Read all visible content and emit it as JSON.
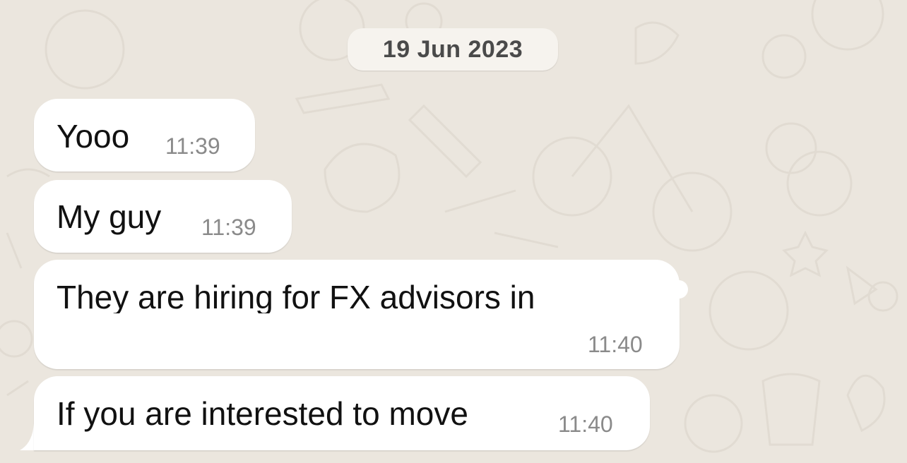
{
  "chat": {
    "date_separator": "19 Jun 2023",
    "messages": [
      {
        "text": "Yooo",
        "time": "11:39"
      },
      {
        "text": "My guy",
        "time": "11:39"
      },
      {
        "text": "They are hiring for FX advisors in ",
        "time": "11:40"
      },
      {
        "text": "If you  are interested to move",
        "time": "11:40"
      }
    ]
  },
  "colors": {
    "wallpaper": "#ebe6de",
    "bubble": "#ffffff",
    "timestamp": "#8a8a8a",
    "date_pill": "#f6f3ee"
  }
}
